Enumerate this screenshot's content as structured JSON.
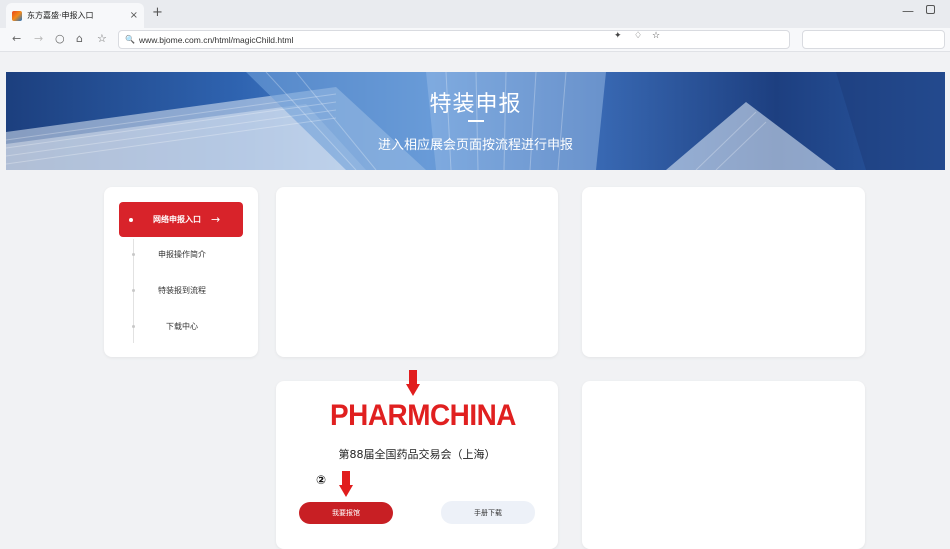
{
  "browser": {
    "tab_title": "东方嘉盛·申报入口",
    "tab_close": "×",
    "new_tab": "+",
    "url": "www.bjome.com.cn/html/magicChild.html",
    "icons": [
      "back-icon",
      "forward-icon",
      "refresh-icon",
      "home-icon",
      "favorite-icon",
      "search-icon",
      "pin-icon",
      "read-aloud-icon",
      "add-favorite-icon"
    ]
  },
  "banner": {
    "title": "特装申报",
    "subtitle": "进入相应展会页面按流程进行申报"
  },
  "sidebar": {
    "active_label": "网络申报入口",
    "active_arrow": "→",
    "items": [
      {
        "label": "申报操作简介"
      },
      {
        "label": "特装报到流程"
      },
      {
        "label": "下载中心"
      }
    ]
  },
  "expo": {
    "logo_text": "PHARMCHINA",
    "name": "第88届全国药品交易会（上海）",
    "step_marker": "②",
    "apply_button": "我要报馆",
    "manual_button": "手册下载"
  },
  "colors": {
    "accent_red": "#d8232a",
    "button_red": "#c81f24",
    "logo_red": "#e02020",
    "page_bg": "#f1f2f4",
    "banner_blue": "#2f64b1"
  }
}
